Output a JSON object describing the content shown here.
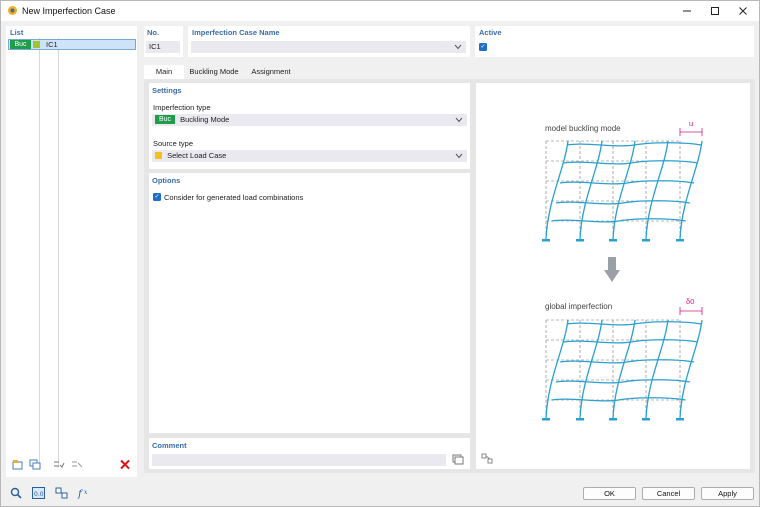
{
  "window": {
    "title": "New Imperfection Case"
  },
  "list": {
    "header": "List",
    "items": [
      {
        "badge": "Buc",
        "name": "IC1"
      }
    ]
  },
  "no": {
    "label": "No.",
    "value": "IC1"
  },
  "case_name": {
    "label": "Imperfection Case Name",
    "value": ""
  },
  "active": {
    "label": "Active",
    "checked": true
  },
  "tabs": [
    {
      "label": "Main"
    },
    {
      "label": "Buckling Mode"
    },
    {
      "label": "Assignment"
    }
  ],
  "settings": {
    "header": "Settings",
    "imperfection_type": {
      "label": "Imperfection type",
      "badge": "Buc",
      "value": "Buckling Mode"
    },
    "source_type": {
      "label": "Source type",
      "value": "Select Load Case"
    }
  },
  "options": {
    "header": "Options",
    "consider_generated": {
      "label": "Consider for generated load combinations",
      "checked": true
    }
  },
  "comment": {
    "label": "Comment",
    "value": ""
  },
  "diagram": {
    "top_caption": "model buckling mode",
    "top_dim": "u",
    "bottom_caption": "global imperfection",
    "bottom_dim": "δ0"
  },
  "buttons": {
    "ok": "OK",
    "cancel": "Cancel",
    "apply": "Apply"
  },
  "colors": {
    "accent": "#3b6da6",
    "badge_green": "#1e9e4a",
    "frame": "#2aa0d0",
    "dim": "#d01b82",
    "source_swatch": "#f2c21b"
  }
}
